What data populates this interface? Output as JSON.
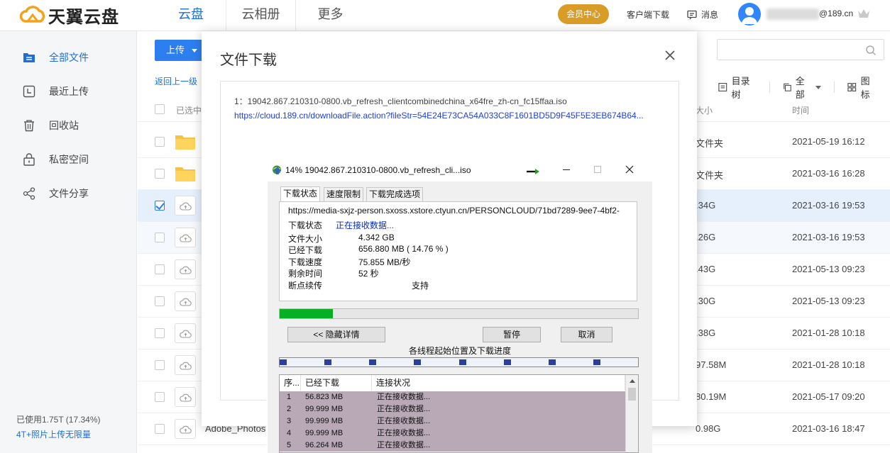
{
  "header": {
    "logo_text": "天翼云盘",
    "nav": [
      "云盘",
      "云相册",
      "更多"
    ],
    "vip_label": "会员中心",
    "client_download": "客户端下载",
    "messages": "消息",
    "account_suffix": "@189.cn"
  },
  "sidebar": {
    "items": [
      {
        "label": "全部文件",
        "icon": "folder-list-icon"
      },
      {
        "label": "最近上传",
        "icon": "clock-icon"
      },
      {
        "label": "回收站",
        "icon": "trash-icon"
      },
      {
        "label": "私密空间",
        "icon": "lock-icon"
      },
      {
        "label": "文件分享",
        "icon": "share-icon"
      }
    ],
    "usage": "已使用1.75T (17.34%)",
    "photo_unlimited": "4T+照片上传无限量"
  },
  "main": {
    "upload_label": "上传",
    "back_link": "返回上一级",
    "toolbar": {
      "directory_tree": "目录树",
      "all": "全部",
      "icons": "图标"
    },
    "list_header": {
      "selected": "已选中",
      "size": "大小",
      "time": "时间"
    },
    "rows": [
      {
        "type": "folder",
        "name": "",
        "size": "文件夹",
        "time": "2021-05-19 16:12",
        "checked": false
      },
      {
        "type": "folder",
        "name": "",
        "size": "文件夹",
        "time": "2021-03-16 16:28",
        "checked": false
      },
      {
        "type": "file",
        "name": "",
        "size": ".34G",
        "time": "2021-03-16 19:53",
        "checked": true
      },
      {
        "type": "file",
        "name": "",
        "size": ".26G",
        "time": "2021-03-16 19:53",
        "checked": false
      },
      {
        "type": "file",
        "name": "",
        "size": ".43G",
        "time": "2021-05-13 09:23",
        "checked": false
      },
      {
        "type": "file",
        "name": "",
        "size": ".30G",
        "time": "2021-05-13 09:23",
        "checked": false
      },
      {
        "type": "file",
        "name": "",
        "size": ".38G",
        "time": "2021-01-28 10:18",
        "checked": false
      },
      {
        "type": "file",
        "name": "",
        "size": "97.58M",
        "time": "2021-01-28 10:18",
        "checked": false
      },
      {
        "type": "file",
        "name": "",
        "size": "80.19M",
        "time": "2021-05-17 09:20",
        "checked": false
      },
      {
        "type": "file",
        "name": "Adobe_Photos",
        "size": "0.98G",
        "time": "2021-03-16 18:47",
        "checked": false
      }
    ]
  },
  "download_dialog": {
    "title": "文件下载",
    "file_line": "1：19042.867.210310-0800.vb_refresh_clientcombinedchina_x64fre_zh-cn_fc15ffaa.iso",
    "url": "https://cloud.189.cn/downloadFile.action?fileStr=54E24E73CA54A033C8F1601BD5D9F45F5E3EB674B64..."
  },
  "idm": {
    "title": "14% 19042.867.210310-0800.vb_refresh_cli...iso",
    "tabs": [
      "下载状态",
      "速度限制",
      "下载完成选项"
    ],
    "url": "https://media-sxjz-person.sxoss.xstore.ctyun.cn/PERSONCLOUD/71bd7289-9ee7-4bf2-",
    "status_label": "下载状态",
    "status_value": "正在接收数据...",
    "fields": [
      {
        "label": "文件大小",
        "value": "4.342  GB"
      },
      {
        "label": "已经下载",
        "value": "656.880  MB  ( 14.76 % )"
      },
      {
        "label": "下载速度",
        "value": "75.855  MB/秒"
      },
      {
        "label": "剩余时间",
        "value": "52 秒"
      },
      {
        "label": "断点续传",
        "value": "支持"
      }
    ],
    "progress_fraction": 0.1476,
    "buttons": {
      "hide_details": "<< 隐藏详情",
      "pause": "暂停",
      "cancel": "取消"
    },
    "thread_caption": "各线程起始位置及下载进度",
    "thread_starts": [
      0.0,
      0.125,
      0.25,
      0.375,
      0.5,
      0.625,
      0.75,
      0.875
    ],
    "table_header": [
      "序...",
      "已经下载",
      "连接状况"
    ],
    "threads": [
      {
        "n": "1",
        "downloaded": "56.823 MB",
        "status": "正在接收数据..."
      },
      {
        "n": "2",
        "downloaded": "99.999 MB",
        "status": "正在接收数据..."
      },
      {
        "n": "3",
        "downloaded": "99.999 MB",
        "status": "正在接收数据..."
      },
      {
        "n": "4",
        "downloaded": "99.999 MB",
        "status": "正在接收数据..."
      },
      {
        "n": "5",
        "downloaded": "96.264 MB",
        "status": "正在接收数据..."
      }
    ]
  },
  "colors": {
    "brand_blue": "#1d6fd8",
    "vip_gold": "#d99c26",
    "progress_green": "#06b025",
    "thread_row": "#b9a9b6"
  }
}
